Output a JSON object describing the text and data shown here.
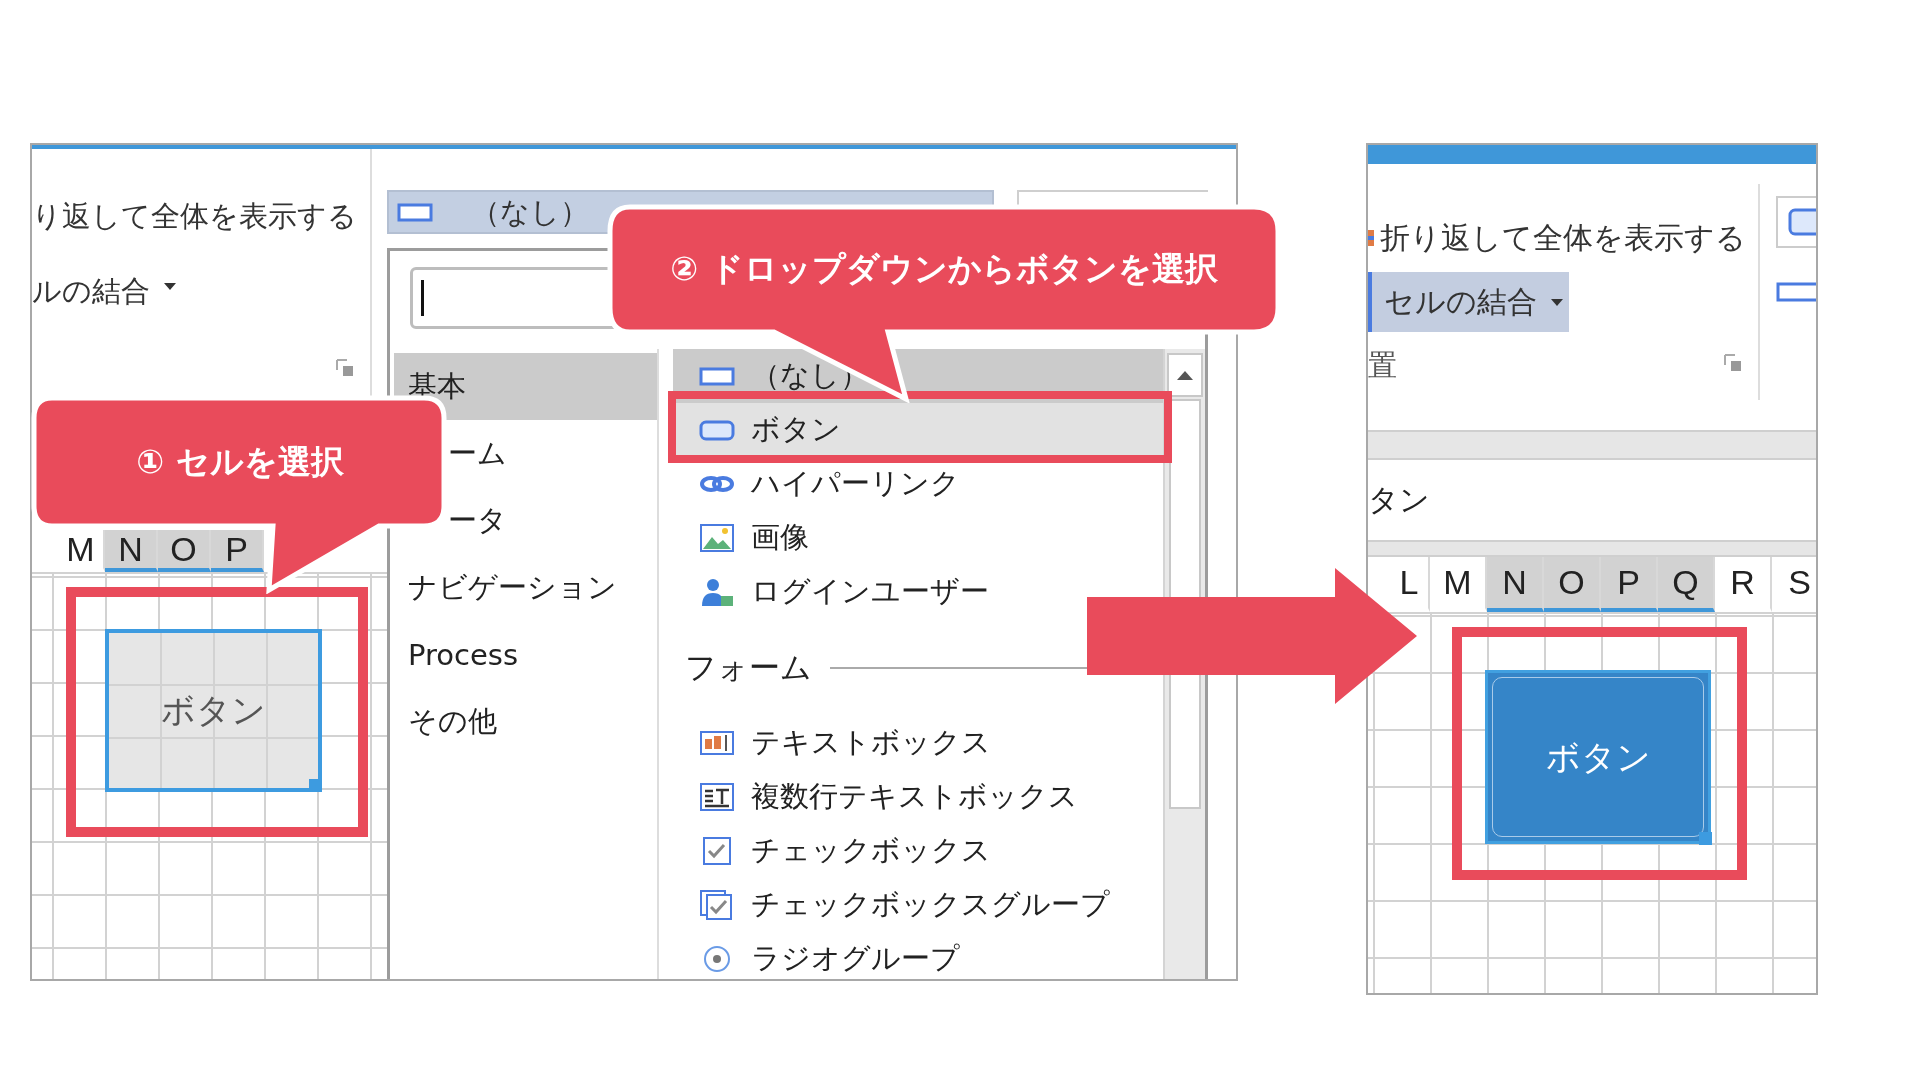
{
  "left_screen": {
    "ribbon": {
      "wrap_text": "り返して全体を表示する",
      "merge_cells": "ルの結合"
    },
    "column_headers": [
      {
        "label": "M",
        "selected": false
      },
      {
        "label": "N",
        "selected": true
      },
      {
        "label": "O",
        "selected": true
      },
      {
        "label": "P",
        "selected": true
      }
    ],
    "selected_cell_text": "ボタン",
    "cell_type_dropdown": {
      "value": "（なし）",
      "categories": [
        {
          "label": "基本",
          "selected": true,
          "cut": false
        },
        {
          "label": "ーム",
          "selected": false,
          "cut": true
        },
        {
          "label": "ータ",
          "selected": false,
          "cut": true
        },
        {
          "label": "ナビゲーション",
          "selected": false,
          "cut": false
        },
        {
          "label": "Process",
          "selected": false,
          "cut": false
        },
        {
          "label": "その他",
          "selected": false,
          "cut": false
        }
      ],
      "items": [
        {
          "kind": "none",
          "label": "（なし）",
          "selected": true,
          "hovered": false
        },
        {
          "kind": "button",
          "label": "ボタン",
          "selected": false,
          "hovered": true
        },
        {
          "kind": "link",
          "label": "ハイパーリンク",
          "selected": false,
          "hovered": false
        },
        {
          "kind": "image",
          "label": "画像",
          "selected": false,
          "hovered": false
        },
        {
          "kind": "user",
          "label": "ログインユーザー",
          "selected": false,
          "hovered": false
        },
        {
          "kind": "section",
          "label": "フォーム"
        },
        {
          "kind": "textbox",
          "label": "テキストボックス",
          "selected": false,
          "hovered": false
        },
        {
          "kind": "multiline",
          "label": "複数行テキストボックス",
          "selected": false,
          "hovered": false
        },
        {
          "kind": "checkbox",
          "label": "チェックボックス",
          "selected": false,
          "hovered": false
        },
        {
          "kind": "checkgroup",
          "label": "チェックボックスグループ",
          "selected": false,
          "hovered": false
        },
        {
          "kind": "radio",
          "label": "ラジオグループ",
          "selected": false,
          "hovered": false
        }
      ]
    }
  },
  "right_screen": {
    "ribbon": {
      "wrap_text": "折り返して全体を表示する",
      "merge_cells": "セルの結合",
      "alignment": "置"
    },
    "formula_text": "タン",
    "column_headers": [
      {
        "label": "L",
        "selected": false
      },
      {
        "label": "M",
        "selected": false
      },
      {
        "label": "N",
        "selected": true
      },
      {
        "label": "O",
        "selected": true
      },
      {
        "label": "P",
        "selected": true
      },
      {
        "label": "Q",
        "selected": true
      },
      {
        "label": "R",
        "selected": false
      },
      {
        "label": "S",
        "selected": false
      }
    ],
    "button_text": "ボタン"
  },
  "callouts": [
    {
      "text": "① セルを選択"
    },
    {
      "text": "② ドロップダウンからボタンを選択"
    }
  ]
}
